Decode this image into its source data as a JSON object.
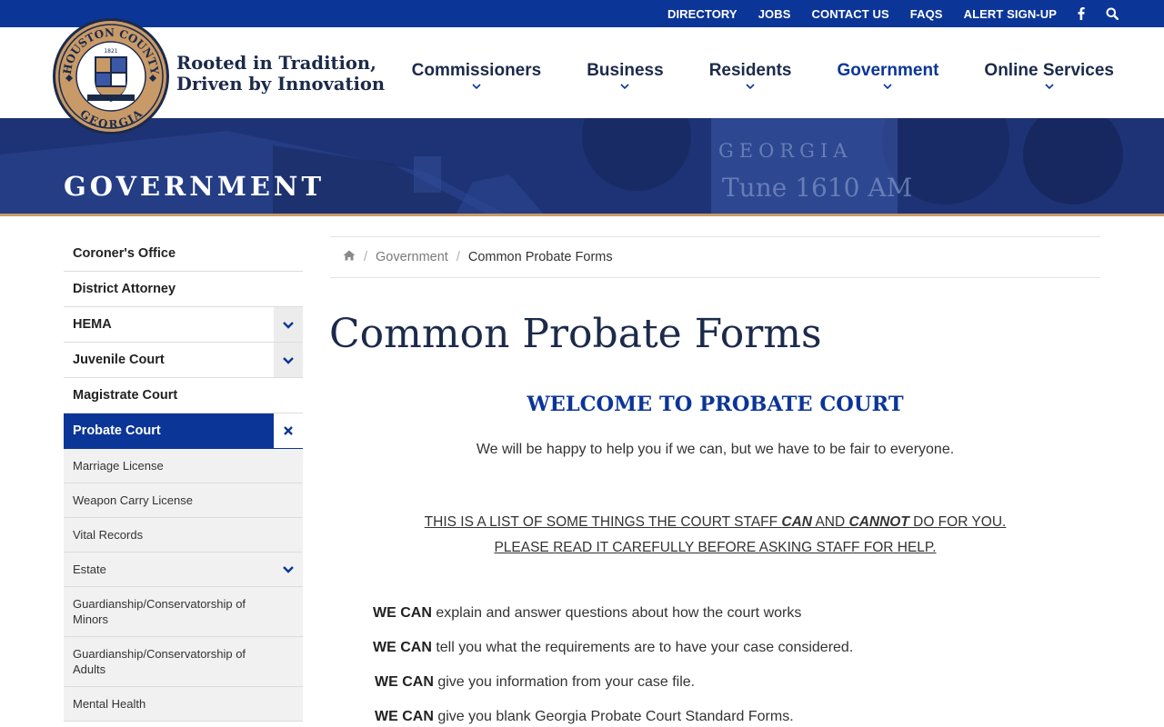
{
  "topbar": {
    "links": [
      "DIRECTORY",
      "JOBS",
      "CONTACT US",
      "FAQS",
      "ALERT SIGN-UP"
    ],
    "facebook_icon": "facebook-icon",
    "search_icon": "search-icon"
  },
  "header": {
    "seal_top": "HOUSTON COUNTY",
    "seal_bottom": "GEORGIA",
    "seal_year": "1821",
    "tagline_line1": "Rooted in Tradition,",
    "tagline_line2": "Driven by Innovation",
    "nav": [
      {
        "label": "Commissioners"
      },
      {
        "label": "Business"
      },
      {
        "label": "Residents"
      },
      {
        "label": "Government"
      },
      {
        "label": "Online Services"
      }
    ]
  },
  "hero": {
    "title": "GOVERNMENT",
    "sign_line1": "GEORGIA",
    "sign_line2": "Tune 1610 AM"
  },
  "sidebar": {
    "items": [
      {
        "label": "Coroner's Office"
      },
      {
        "label": "District Attorney"
      },
      {
        "label": "HEMA"
      },
      {
        "label": "Juvenile Court"
      },
      {
        "label": "Magistrate Court"
      },
      {
        "label": "Probate Court"
      }
    ],
    "subitems": [
      {
        "label": "Marriage License"
      },
      {
        "label": "Weapon Carry License"
      },
      {
        "label": "Vital Records"
      },
      {
        "label": "Estate"
      },
      {
        "label": "Guardianship/Conservatorship of Minors"
      },
      {
        "label": "Guardianship/Conservatorship of Adults"
      },
      {
        "label": "Mental Health"
      }
    ]
  },
  "breadcrumb": {
    "home_icon": "home-icon",
    "parent": "Government",
    "current": "Common Probate Forms"
  },
  "main": {
    "title": "Common Probate Forms",
    "welcome": "WELCOME TO PROBATE COURT",
    "intro": "We will be happy to help you if we can, but we have to be fair to everyone.",
    "notice_part1": "THIS IS A LIST OF SOME THINGS THE COURT STAFF ",
    "notice_can": "CAN",
    "notice_and": " AND ",
    "notice_cannot": "CANNOT",
    "notice_part2": " DO FOR YOU.",
    "notice_line2": "PLEASE READ IT CAREFULLY BEFORE ASKING STAFF FOR HELP.",
    "can_items": [
      {
        "lead": "WE CAN",
        "text": " explain and answer questions about how the court works"
      },
      {
        "lead": "WE CAN",
        "text": " tell you what the requirements are to have your case considered."
      },
      {
        "lead": "WE CAN",
        "text": " give you information from your case file."
      },
      {
        "lead": "WE CAN",
        "text": " give you blank Georgia Probate Court Standard Forms."
      }
    ]
  },
  "colors": {
    "brand_blue": "#0b3597",
    "navy_text": "#1c2a4a",
    "accent_tan": "#c89a68"
  }
}
